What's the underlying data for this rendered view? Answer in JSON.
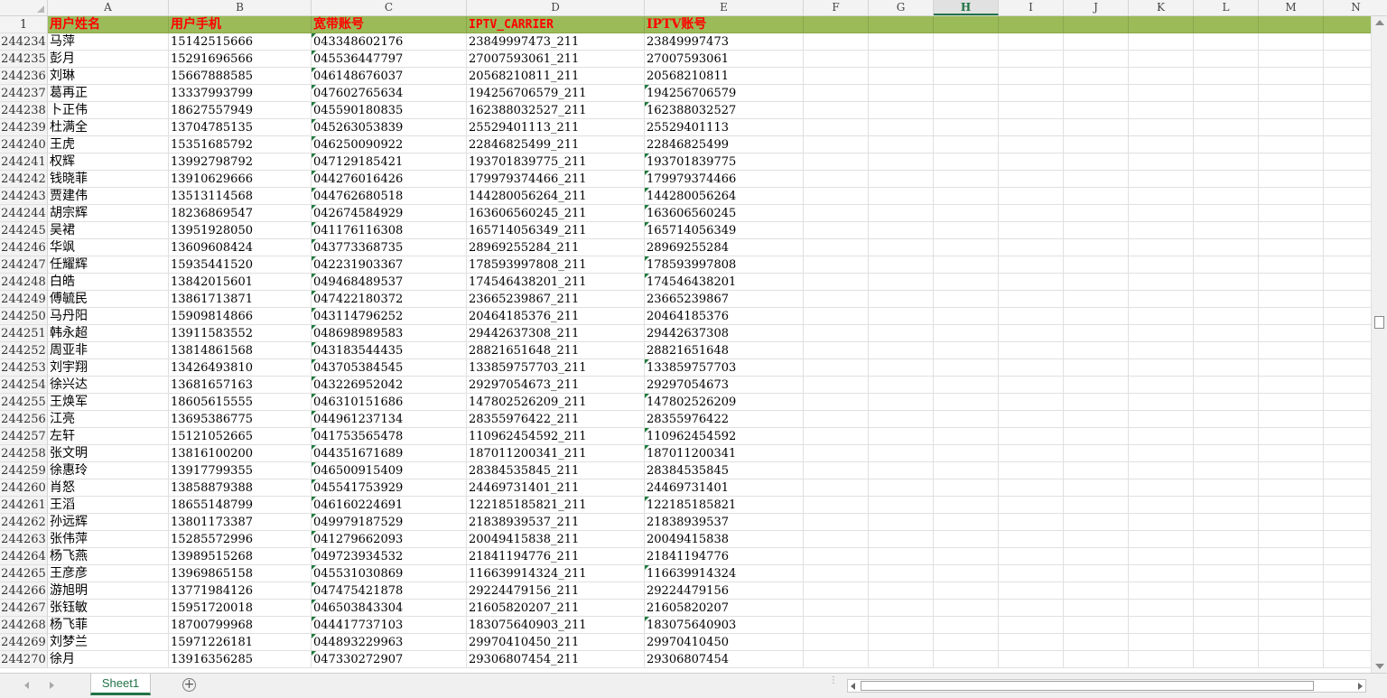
{
  "column_headers": [
    "A",
    "B",
    "C",
    "D",
    "E",
    "F",
    "G",
    "H",
    "I",
    "J",
    "K",
    "L",
    "M",
    "N"
  ],
  "selected_column": "H",
  "header_row": {
    "num": "1",
    "cells": [
      "用户姓名",
      "用户手机",
      "宽带账号",
      "IPTV_CARRIER",
      "IPTV账号"
    ]
  },
  "rows": [
    {
      "num": "244234",
      "name": "马萍",
      "phone": "15142515666",
      "broadband": "043348602176",
      "carrier": "23849997473_211",
      "iptv": "23849997473"
    },
    {
      "num": "244235",
      "name": "彭月",
      "phone": "15291696566",
      "broadband": "045536447797",
      "carrier": "27007593061_211",
      "iptv": "27007593061"
    },
    {
      "num": "244236",
      "name": "刘琳",
      "phone": "15667888585",
      "broadband": "046148676037",
      "carrier": "20568210811_211",
      "iptv": "20568210811"
    },
    {
      "num": "244237",
      "name": "葛再正",
      "phone": "13337993799",
      "broadband": "047602765634",
      "carrier": "194256706579_211",
      "iptv": "194256706579"
    },
    {
      "num": "244238",
      "name": "卜正伟",
      "phone": "18627557949",
      "broadband": "045590180835",
      "carrier": "162388032527_211",
      "iptv": "162388032527"
    },
    {
      "num": "244239",
      "name": "杜满全",
      "phone": "13704785135",
      "broadband": "045263053839",
      "carrier": "25529401113_211",
      "iptv": "25529401113"
    },
    {
      "num": "244240",
      "name": "王虎",
      "phone": "15351685792",
      "broadband": "046250090922",
      "carrier": "22846825499_211",
      "iptv": "22846825499"
    },
    {
      "num": "244241",
      "name": "权辉",
      "phone": "13992798792",
      "broadband": "047129185421",
      "carrier": "193701839775_211",
      "iptv": "193701839775"
    },
    {
      "num": "244242",
      "name": "钱晓菲",
      "phone": "13910629666",
      "broadband": "044276016426",
      "carrier": "179979374466_211",
      "iptv": "179979374466"
    },
    {
      "num": "244243",
      "name": "贾建伟",
      "phone": "13513114568",
      "broadband": "044762680518",
      "carrier": "144280056264_211",
      "iptv": "144280056264"
    },
    {
      "num": "244244",
      "name": "胡宗辉",
      "phone": "18236869547",
      "broadband": "042674584929",
      "carrier": "163606560245_211",
      "iptv": "163606560245"
    },
    {
      "num": "244245",
      "name": "吴裙",
      "phone": "13951928050",
      "broadband": "041176116308",
      "carrier": "165714056349_211",
      "iptv": "165714056349"
    },
    {
      "num": "244246",
      "name": "华飒",
      "phone": "13609608424",
      "broadband": "043773368735",
      "carrier": "28969255284_211",
      "iptv": "28969255284"
    },
    {
      "num": "244247",
      "name": "任耀辉",
      "phone": "15935441520",
      "broadband": "042231903367",
      "carrier": "178593997808_211",
      "iptv": "178593997808"
    },
    {
      "num": "244248",
      "name": "白皓",
      "phone": "13842015601",
      "broadband": "049468489537",
      "carrier": "174546438201_211",
      "iptv": "174546438201"
    },
    {
      "num": "244249",
      "name": "傅毓民",
      "phone": "13861713871",
      "broadband": "047422180372",
      "carrier": "23665239867_211",
      "iptv": "23665239867"
    },
    {
      "num": "244250",
      "name": "马丹阳",
      "phone": "15909814866",
      "broadband": "043114796252",
      "carrier": "20464185376_211",
      "iptv": "20464185376"
    },
    {
      "num": "244251",
      "name": "韩永超",
      "phone": "13911583552",
      "broadband": "048698989583",
      "carrier": "29442637308_211",
      "iptv": "29442637308"
    },
    {
      "num": "244252",
      "name": "周亚非",
      "phone": "13814861568",
      "broadband": "043183544435",
      "carrier": "28821651648_211",
      "iptv": "28821651648"
    },
    {
      "num": "244253",
      "name": "刘宇翔",
      "phone": "13426493810",
      "broadband": "043705384545",
      "carrier": "133859757703_211",
      "iptv": "133859757703"
    },
    {
      "num": "244254",
      "name": "徐兴达",
      "phone": "13681657163",
      "broadband": "043226952042",
      "carrier": "29297054673_211",
      "iptv": "29297054673"
    },
    {
      "num": "244255",
      "name": "王焕军",
      "phone": "18605615555",
      "broadband": "046310151686",
      "carrier": "147802526209_211",
      "iptv": "147802526209"
    },
    {
      "num": "244256",
      "name": "江亮",
      "phone": "13695386775",
      "broadband": "044961237134",
      "carrier": "28355976422_211",
      "iptv": "28355976422"
    },
    {
      "num": "244257",
      "name": "左轩",
      "phone": "15121052665",
      "broadband": "041753565478",
      "carrier": "110962454592_211",
      "iptv": "110962454592"
    },
    {
      "num": "244258",
      "name": "张文明",
      "phone": "13816100200",
      "broadband": "044351671689",
      "carrier": "187011200341_211",
      "iptv": "187011200341"
    },
    {
      "num": "244259",
      "name": "徐惠玲",
      "phone": "13917799355",
      "broadband": "046500915409",
      "carrier": "28384535845_211",
      "iptv": "28384535845"
    },
    {
      "num": "244260",
      "name": "肖怒",
      "phone": "13858879388",
      "broadband": "045541753929",
      "carrier": "24469731401_211",
      "iptv": "24469731401"
    },
    {
      "num": "244261",
      "name": "王滔",
      "phone": "18655148799",
      "broadband": "046160224691",
      "carrier": "122185185821_211",
      "iptv": "122185185821"
    },
    {
      "num": "244262",
      "name": "孙远辉",
      "phone": "13801173387",
      "broadband": "049979187529",
      "carrier": "21838939537_211",
      "iptv": "21838939537"
    },
    {
      "num": "244263",
      "name": "张伟萍",
      "phone": "15285572996",
      "broadband": "041279662093",
      "carrier": "20049415838_211",
      "iptv": "20049415838"
    },
    {
      "num": "244264",
      "name": "杨飞燕",
      "phone": "13989515268",
      "broadband": "049723934532",
      "carrier": "21841194776_211",
      "iptv": "21841194776"
    },
    {
      "num": "244265",
      "name": "王彦彦",
      "phone": "13969865158",
      "broadband": "045531030869",
      "carrier": "116639914324_211",
      "iptv": "116639914324"
    },
    {
      "num": "244266",
      "name": "游旭明",
      "phone": "13771984126",
      "broadband": "047475421878",
      "carrier": "29224479156_211",
      "iptv": "29224479156"
    },
    {
      "num": "244267",
      "name": "张钰敏",
      "phone": "15951720018",
      "broadband": "046503843304",
      "carrier": "21605820207_211",
      "iptv": "21605820207"
    },
    {
      "num": "244268",
      "name": "杨飞菲",
      "phone": "18700799968",
      "broadband": "044417737103",
      "carrier": "183075640903_211",
      "iptv": "183075640903"
    },
    {
      "num": "244269",
      "name": "刘梦兰",
      "phone": "15971226181",
      "broadband": "044893229963",
      "carrier": "29970410450_211",
      "iptv": "29970410450"
    },
    {
      "num": "244270",
      "name": "徐月",
      "phone": "13916356285",
      "broadband": "047330272907",
      "carrier": "29306807454_211",
      "iptv": "29306807454"
    }
  ],
  "sheet_tab_label": "Sheet1",
  "add_sheet_label": "+",
  "icons": {
    "corner": "select-all-triangle-icon",
    "nav_prev": "sheet-nav-prev-icon",
    "nav_next": "sheet-nav-next-icon",
    "add_sheet": "plus-circle-icon",
    "scroll_up": "scroll-up-arrow-icon",
    "scroll_down": "scroll-down-arrow-icon",
    "scroll_left": "scroll-left-arrow-icon",
    "scroll_right": "scroll-right-arrow-icon"
  },
  "colors": {
    "header_fill": "#9bbb59",
    "header_text": "#ff0000",
    "accent": "#217346",
    "error_marker": "#1e7a3c"
  }
}
